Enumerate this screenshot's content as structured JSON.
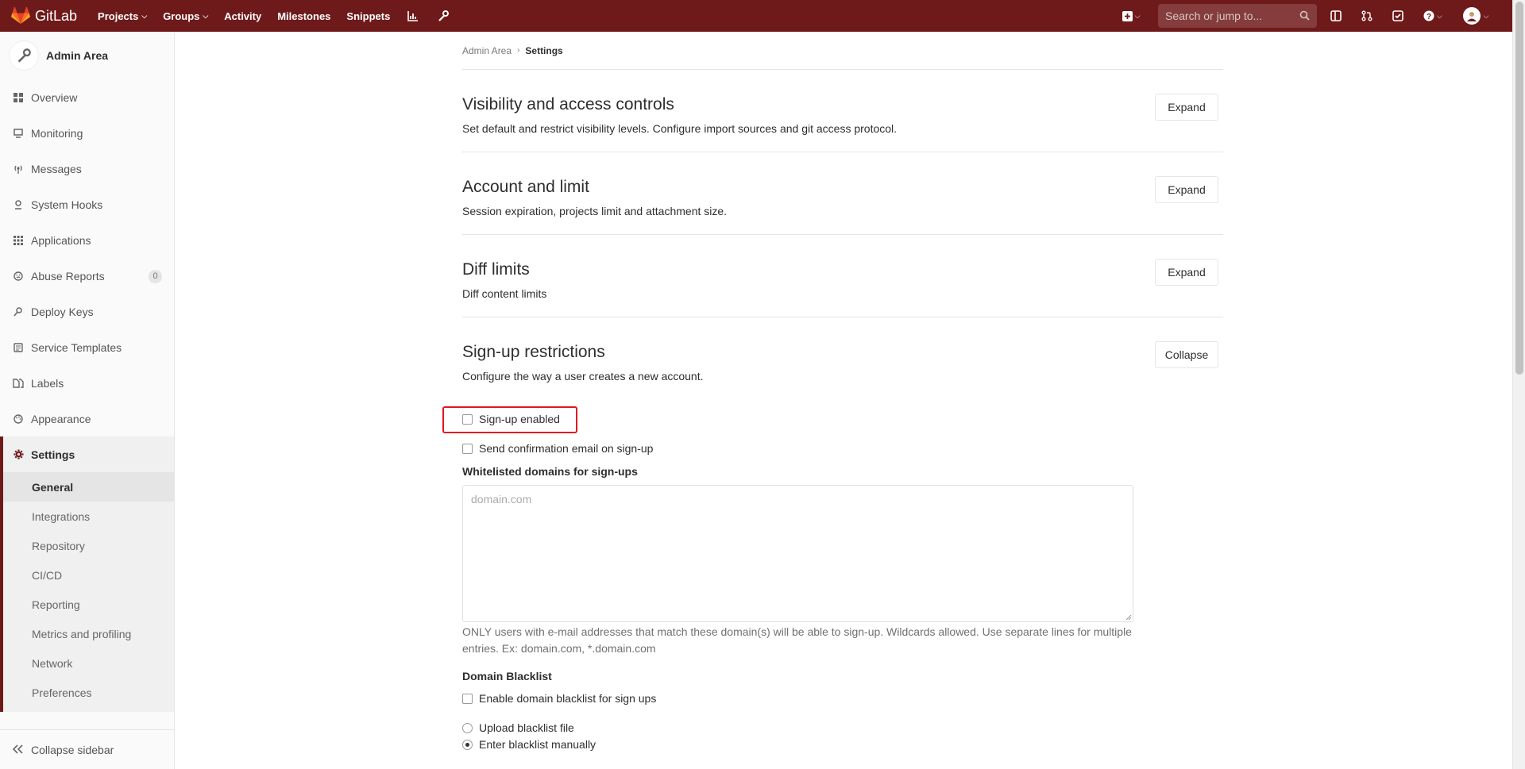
{
  "navbar": {
    "brand": "GitLab",
    "links": [
      {
        "label": "Projects",
        "caret": true
      },
      {
        "label": "Groups",
        "caret": true
      },
      {
        "label": "Activity",
        "caret": false
      },
      {
        "label": "Milestones",
        "caret": false
      },
      {
        "label": "Snippets",
        "caret": false
      }
    ],
    "search_placeholder": "Search or jump to...",
    "bg_color": "#6f1a1a"
  },
  "sidebar": {
    "title": "Admin Area",
    "items": [
      {
        "label": "Overview",
        "icon": "grid-icon"
      },
      {
        "label": "Monitoring",
        "icon": "monitor-icon"
      },
      {
        "label": "Messages",
        "icon": "broadcast-icon"
      },
      {
        "label": "System Hooks",
        "icon": "hook-icon"
      },
      {
        "label": "Applications",
        "icon": "apps-icon"
      },
      {
        "label": "Abuse Reports",
        "icon": "abuse-icon",
        "count": "0"
      },
      {
        "label": "Deploy Keys",
        "icon": "key-icon"
      },
      {
        "label": "Service Templates",
        "icon": "template-icon"
      },
      {
        "label": "Labels",
        "icon": "labels-icon"
      },
      {
        "label": "Appearance",
        "icon": "palette-icon"
      },
      {
        "label": "Settings",
        "icon": "gear-icon",
        "active": true
      }
    ],
    "settings_sub": [
      {
        "label": "General",
        "active": true
      },
      {
        "label": "Integrations"
      },
      {
        "label": "Repository"
      },
      {
        "label": "CI/CD"
      },
      {
        "label": "Reporting"
      },
      {
        "label": "Metrics and profiling"
      },
      {
        "label": "Network"
      },
      {
        "label": "Preferences"
      }
    ],
    "collapse_label": "Collapse sidebar"
  },
  "breadcrumb": {
    "parent": "Admin Area",
    "current": "Settings"
  },
  "sections": [
    {
      "title": "Visibility and access controls",
      "description": "Set default and restrict visibility levels. Configure import sources and git access protocol.",
      "button": "Expand"
    },
    {
      "title": "Account and limit",
      "description": "Session expiration, projects limit and attachment size.",
      "button": "Expand"
    },
    {
      "title": "Diff limits",
      "description": "Diff content limits",
      "button": "Expand"
    },
    {
      "title": "Sign-up restrictions",
      "description": "Configure the way a user creates a new account.",
      "button": "Collapse"
    }
  ],
  "signup": {
    "signup_enabled_label": "Sign-up enabled",
    "signup_enabled": false,
    "confirmation_label": "Send confirmation email on sign-up",
    "whitelist_label": "Whitelisted domains for sign-ups",
    "whitelist_placeholder": "domain.com",
    "whitelist_help": "ONLY users with e-mail addresses that match these domain(s) will be able to sign-up. Wildcards allowed. Use separate lines for multiple entries. Ex: domain.com, *.domain.com",
    "blacklist_heading": "Domain Blacklist",
    "blacklist_enable_label": "Enable domain blacklist for sign ups",
    "upload_option": "Upload blacklist file",
    "manual_option": "Enter blacklist manually",
    "selected_option": "Enter blacklist manually"
  }
}
